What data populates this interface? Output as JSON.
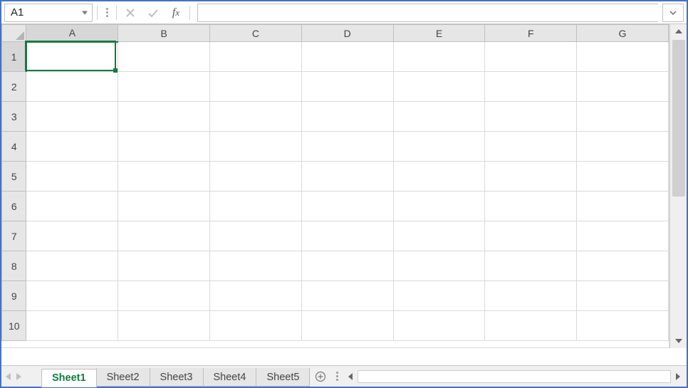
{
  "namebox": {
    "value": "A1"
  },
  "formula_bar": {
    "value": ""
  },
  "columns": [
    "A",
    "B",
    "C",
    "D",
    "E",
    "F",
    "G"
  ],
  "rows": [
    "1",
    "2",
    "3",
    "4",
    "5",
    "6",
    "7",
    "8",
    "9",
    "10"
  ],
  "selection": {
    "cell": "A1",
    "col_index": 0,
    "row_index": 0
  },
  "sheets": {
    "active_index": 0,
    "tabs": [
      "Sheet1",
      "Sheet2",
      "Sheet3",
      "Sheet4",
      "Sheet5"
    ]
  }
}
